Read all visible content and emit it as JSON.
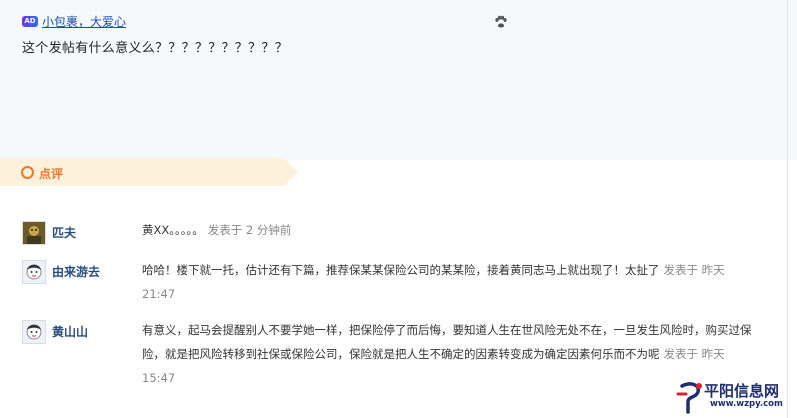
{
  "ad": {
    "badge": "AD",
    "text": "小包裹，大爱心"
  },
  "post": {
    "text": "这个发帖有什么意义么？？？？？？？？？？"
  },
  "comments_section": {
    "title": "点评"
  },
  "comments": [
    {
      "user": "匹夫",
      "text": "黄XX。。。。。",
      "time": "发表于 2 分钟前"
    },
    {
      "user": "由来游去",
      "text": "哈哈！楼下就一托，估计还有下篇，推荐保某某保险公司的某某险，接着黄同志马上就出现了！太扯了",
      "time": "发表于 昨天 21:47"
    },
    {
      "user": "黄山山",
      "text": "有意义，起马会提醒别人不要学她一样，把保险停了而后悔，要知道人生在世风险无处不在，一旦发生风险时，购买过保险，就是把风险转移到社保或保险公司，保险就是把人生不确定的因素转变成为确定因素何乐而不为呢",
      "time": "发表于 昨天 15:47"
    }
  ],
  "logo": {
    "name": "平阳信息网",
    "url": "www.wzpy.com"
  },
  "colors": {
    "accent": "#e8782a",
    "bar": "#fdf1dc",
    "link": "#1a4ea7",
    "username": "#2a4c7d"
  }
}
